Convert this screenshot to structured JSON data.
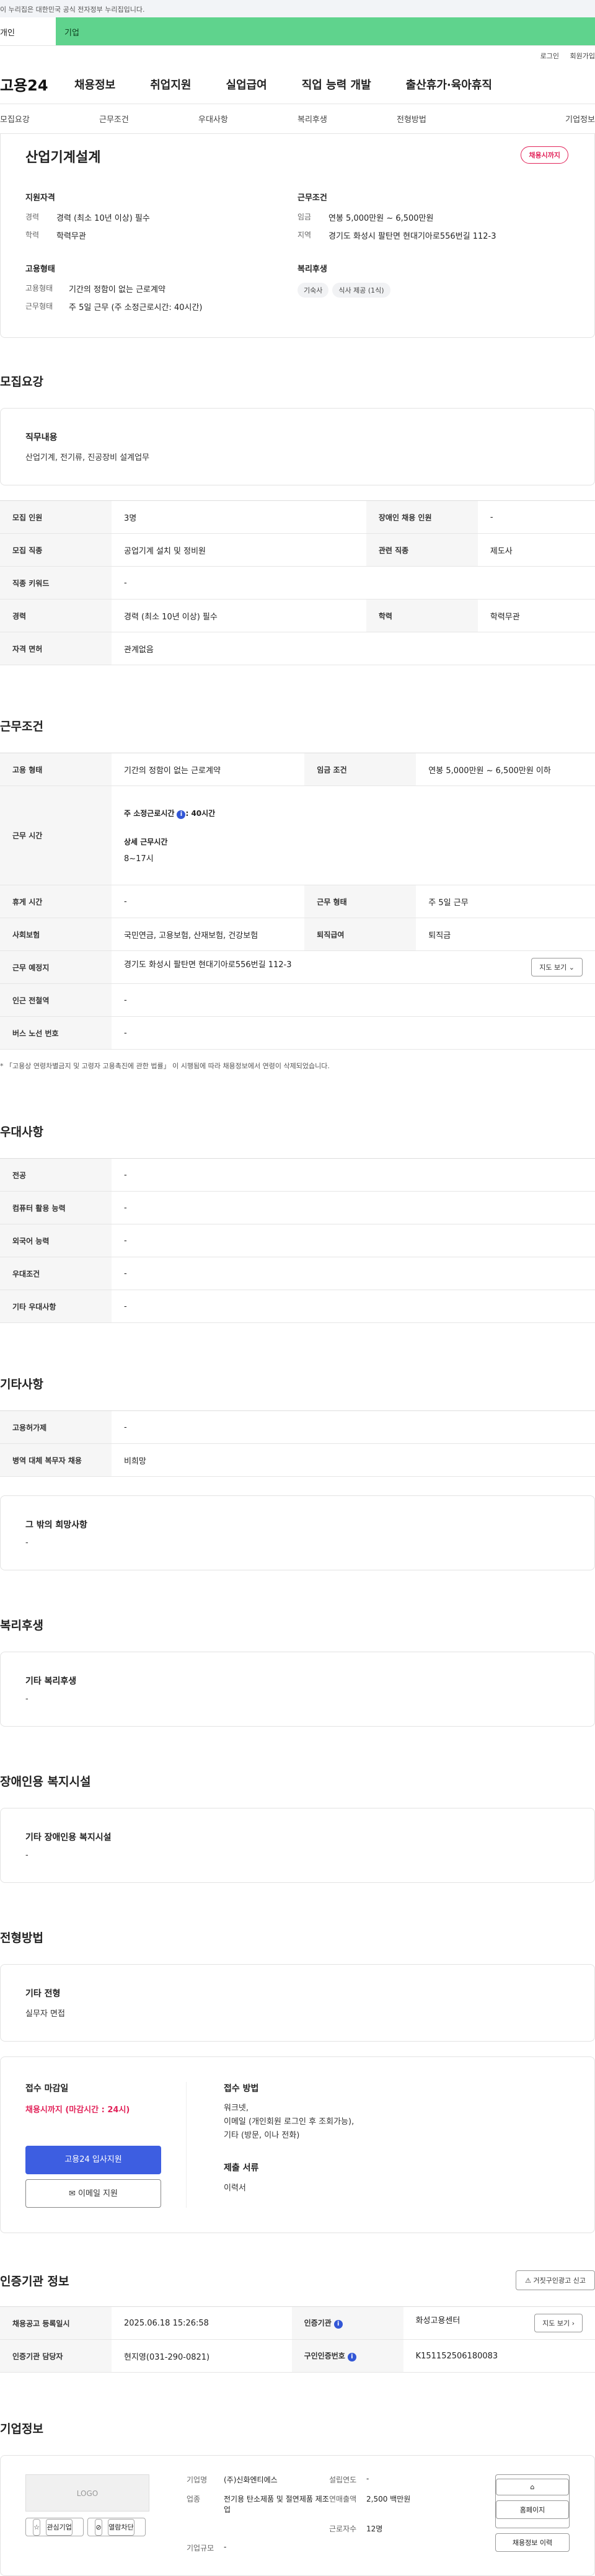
{
  "gov_banner": "이 누리집은 대한민국 공식 전자정부 누리집입니다.",
  "tabs": {
    "personal": "개인",
    "company": "기업"
  },
  "util": {
    "login": "로그인",
    "join": "회원가입"
  },
  "logo": "고용24",
  "gnb": [
    "채용정보",
    "취업지원",
    "실업급여",
    "직업 능력 개발",
    "출산휴가·육아휴직"
  ],
  "subnav": [
    "모집요강",
    "근무조건",
    "우대사항",
    "복리후생",
    "전형방법",
    "기업정보"
  ],
  "summary": {
    "title": "산업기계설계",
    "badge": "채용시까지",
    "qual_h": "지원자격",
    "career_k": "경력",
    "career_v": "경력 (최소 10년 이상) 필수",
    "edu_k": "학력",
    "edu_v": "학력무관",
    "emp_h": "고용형태",
    "emptype_k": "고용형태",
    "emptype_v": "기간의 정함이 없는 근로계약",
    "worktype_k": "근무형태",
    "worktype_v": "주 5일 근무 (주 소정근로시간: 40시간)",
    "cond_h": "근무조건",
    "wage_k": "임금",
    "wage_v": "연봉 5,000만원 ~ 6,500만원",
    "region_k": "지역",
    "region_v": "경기도 화성시 팔탄면 현대기아로556번길 112-3",
    "welfare_h": "복리후생",
    "chips": [
      "기숙사",
      "식사 제공 (1식)"
    ]
  },
  "recruit": {
    "h": "모집요강",
    "duty_h": "직무내용",
    "duty_v": "산업기계, 전기류, 진공장비 설계업무",
    "rows": [
      [
        "모집 인원",
        "3명",
        "장애인 채용 인원",
        "-"
      ],
      [
        "모집 직종",
        "공업기계 설치 및 정비원",
        "관련 직종",
        "제도사"
      ],
      [
        "직종 키워드",
        "-",
        "",
        ""
      ],
      [
        "경력",
        "경력 (최소 10년 이상) 필수",
        "학력",
        "학력무관"
      ],
      [
        "자격 면허",
        "관계없음",
        "",
        ""
      ]
    ]
  },
  "conditions": {
    "h": "근무조건",
    "emp_k": "고용 형태",
    "emp_v": "기간의 정함이 없는 근로계약",
    "wage_k": "임금 조건",
    "wage_v": "연봉 5,000만원 ~ 6,500만원 이하",
    "hours_k": "근무 시간",
    "hours_v1": "주 소정근로시간",
    "hours_v2": ": 40시간",
    "hours_v3": "상세 근무시간",
    "hours_v4": "8~17시",
    "rest_k": "휴게 시간",
    "rest_v": "-",
    "form_k": "근무 형태",
    "form_v": "주 5일 근무",
    "ins_k": "사회보험",
    "ins_v": "국민연금, 고용보험, 산재보험, 건강보험",
    "ret_k": "퇴직급여",
    "ret_v": "퇴직금",
    "place_k": "근무 예정지",
    "place_v": "경기도 화성시 팔탄면 현대기아로556번길 112-3",
    "map": "지도 보기",
    "sub_k": "인근 전철역",
    "sub_v": "-",
    "bus_k": "버스 노선 번호",
    "bus_v": "-",
    "note": "* 「고용상 연령차별금지 및 고령자 고용촉진에 관한 법률」 이 시행됨에 따라 채용정보에서 연령이 삭제되었습니다."
  },
  "pref": {
    "h": "우대사항",
    "rows": [
      [
        "전공",
        "-"
      ],
      [
        "컴퓨터 활용 능력",
        "-"
      ],
      [
        "외국어 능력",
        "-"
      ],
      [
        "우대조건",
        "-"
      ],
      [
        "기타 우대사항",
        "-"
      ]
    ]
  },
  "etc": {
    "h": "기타사항",
    "rows": [
      [
        "고용허가제",
        "-"
      ],
      [
        "병역 대체 복무자 채용",
        "비희망"
      ]
    ],
    "other_h": "그 밖의 희망사항",
    "other_v": "-"
  },
  "welfare": {
    "h": "복리후생",
    "sub_h": "기타 복리후생",
    "sub_v": "-"
  },
  "disabled": {
    "h": "장애인용 복지시설",
    "sub_h": "기타 장애인용 복지시설",
    "sub_v": "-"
  },
  "process": {
    "h": "전형방법",
    "sub_h": "기타 전형",
    "sub_v": "실무자 면접",
    "deadline_h": "접수 마감일",
    "deadline_v": "채용시까지 (마감시간 : 24시)",
    "apply_btn": "고용24 입사지원",
    "email_btn": "이메일 지원",
    "method_h": "접수 방법",
    "method_v1": "워크넷,",
    "method_v2": "이메일 (개인회원 로그인 후 조회가능),",
    "method_v3": "기타 (방문, 이나 전화)",
    "docs_h": "제출 서류",
    "docs_v": "이력서"
  },
  "cert": {
    "h": "인증기관 정보",
    "report": "거짓구인광고 신고",
    "reg_k": "채용공고 등록일시",
    "reg_v": "2025.06.18 15:26:58",
    "org_k": "인증기관",
    "org_v": "화성고용센터",
    "map": "지도 보기",
    "mgr_k": "인증기관 담당자",
    "mgr_v": "현지영(031-290-0821)",
    "num_k": "구인인증번호",
    "num_v": "K151152506180083"
  },
  "company": {
    "h": "기업정보",
    "logo": "LOGO",
    "fav": "관심기업",
    "block": "열람차단",
    "name_k": "기업명",
    "name_v": "(주)신화엔티에스",
    "est_k": "설립연도",
    "est_v": "-",
    "biz_k": "업종",
    "biz_v": "전기용 탄소제품 및 절연제품 제조업",
    "sales_k": "연매출액",
    "sales_v": "2,500 백만원",
    "emp_k": "근로자수",
    "emp_v": "12명",
    "size_k": "기업규모",
    "size_v": "-",
    "homepage": "홈페이지",
    "history": "채용정보 이력"
  }
}
